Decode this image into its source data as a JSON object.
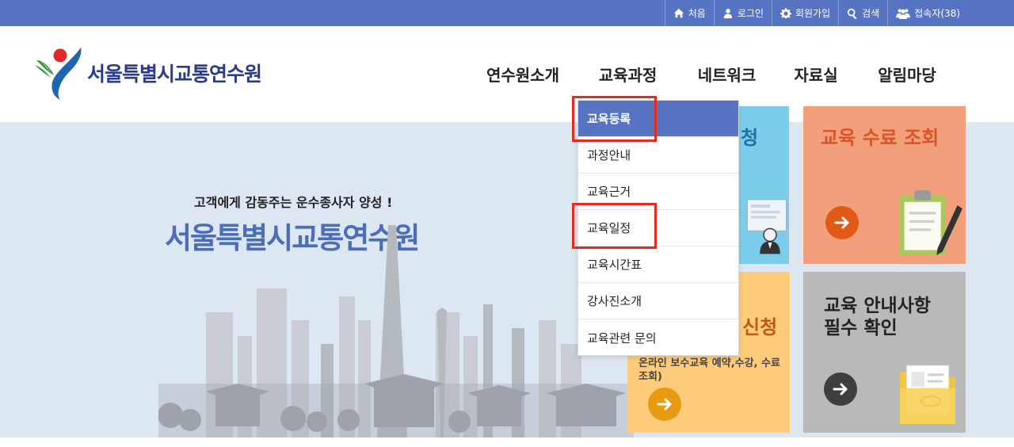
{
  "topbar": {
    "links": [
      {
        "label": "처음",
        "icon": "home-icon"
      },
      {
        "label": "로그인",
        "icon": "user-icon"
      },
      {
        "label": "회원가입",
        "icon": "gear-icon"
      },
      {
        "label": "검색",
        "icon": "search-icon"
      },
      {
        "label": "접속자(38)",
        "icon": "users-icon"
      }
    ]
  },
  "header": {
    "logo_text": "서울특별시교통연수원",
    "nav": [
      "연수원소개",
      "교육과정",
      "네트워크",
      "자료실",
      "알림마당"
    ]
  },
  "hero": {
    "subtitle": "고객에게 감동주는 운수종사자 양성 !",
    "title": "서울특별시교통연수원"
  },
  "dropdown": {
    "items": [
      "교육등록",
      "과정안내",
      "교육근거",
      "교육일정",
      "교육시간표",
      "강사진소개",
      "교육관련 문의"
    ],
    "active_index": 0,
    "highlighted": [
      "교육등록",
      "교육일정"
    ]
  },
  "tiles": {
    "blue_partial": "청",
    "orange_title": "교육 수료 조회",
    "yellow_partial": "신청",
    "yellow_desc_partial": "",
    "yellow_desc": "온라인 보수교육 예약,수강, 수료 조회)",
    "gray_title_line1": "교육 안내사항",
    "gray_title_line2": "필수 확인"
  },
  "colors": {
    "topbar": "#5674c2",
    "hero_bg": "#dce7f2",
    "accent_red": "#e8291d",
    "tile_blue": "#7ccdec",
    "tile_orange": "#f2a07b",
    "tile_yellow": "#fdcc7a",
    "tile_gray": "#b9b9b9"
  }
}
